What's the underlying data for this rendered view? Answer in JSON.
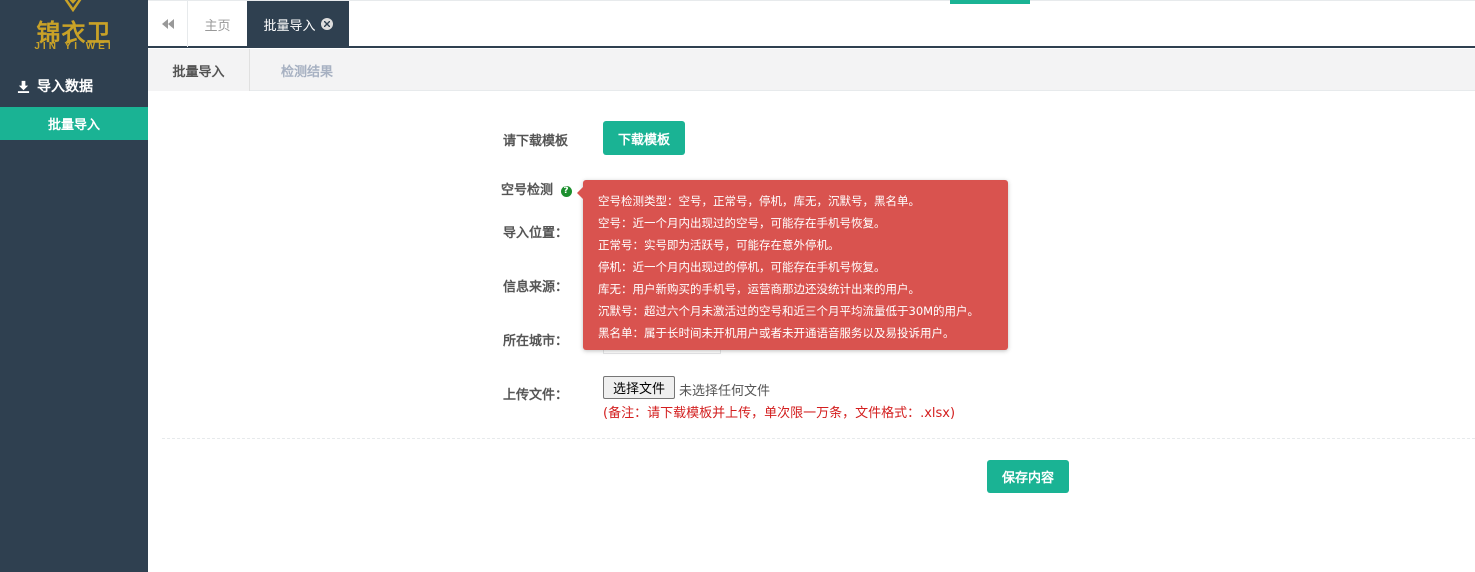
{
  "sidebar": {
    "logo_text": "锦衣卫",
    "logo_sub": "JIN YI WEI",
    "section_label": "导入数据",
    "section_icon": "download-icon",
    "active_item": "批量导入",
    "accent_color": "#1ab394",
    "bg_color": "#2f4050"
  },
  "tabs": {
    "home": "主页",
    "current": "批量导入"
  },
  "subtabs": {
    "active": "批量导入",
    "inactive": "检测结果"
  },
  "form": {
    "template_label": "请下载模板",
    "download_button": "下载模板",
    "detect_label": "空号检测",
    "position_label": "导入位置：",
    "source_label": "信息来源：",
    "city_label": "所在城市：",
    "upload_label": "上传文件：",
    "file_button": "选择文件",
    "file_status": "未选择任何文件",
    "note": "(备注：请下载模板并上传，单次限一万条，文件格式：.xlsx)",
    "save_button": "保存内容"
  },
  "tooltip": {
    "lines": [
      "空号检测类型：空号，正常号，停机，库无，沉默号，黑名单。",
      "空号：近一个月内出现过的空号，可能存在手机号恢复。",
      "正常号：实号即为活跃号，可能存在意外停机。",
      "停机：近一个月内出现过的停机，可能存在手机号恢复。",
      "库无：用户新购买的手机号，运营商那边还没统计出来的用户。",
      "沉默号：超过六个月未激活过的空号和近三个月平均流量低于30M的用户。",
      "黑名单：属于长时间未开机用户或者未开通语音服务以及易投诉用户。"
    ],
    "bg_color": "#d9534f"
  }
}
